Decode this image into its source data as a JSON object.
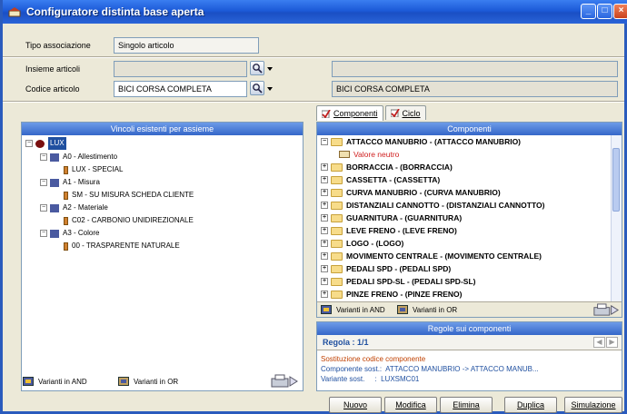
{
  "window": {
    "title": "Configuratore distinta base aperta"
  },
  "form": {
    "tipo_label": "Tipo associazione",
    "tipo_value": "Singolo articolo",
    "insieme_label": "Insieme articoli",
    "codice_label": "Codice articolo",
    "codice_value": "BICI CORSA COMPLETA",
    "right_desc_value": "BICI CORSA COMPLETA"
  },
  "left_panel": {
    "header": "Vincoli esistenti per assieme",
    "tree": {
      "root": "LUX",
      "nodes": [
        {
          "label": "A0 - Allestimento",
          "child": "LUX - SPECIAL"
        },
        {
          "label": "A1 - Misura",
          "child": "SM - SU MISURA SCHEDA CLIENTE"
        },
        {
          "label": "A2 - Materiale",
          "child": "C02 - CARBONIO UNIDIREZIONALE"
        },
        {
          "label": "A3 - Colore",
          "child": "00 - TRASPARENTE NATURALE"
        }
      ]
    },
    "legend_and": "Varianti in AND",
    "legend_or": "Varianti in OR"
  },
  "tabs": {
    "componenti": "Componenti",
    "ciclo": "Ciclo"
  },
  "components_panel": {
    "header": "Componenti",
    "valore_neutro": "Valore neutro",
    "items": [
      "ATTACCO MANUBRIO - (ATTACCO MANUBRIO)",
      "BORRACCIA - (BORRACCIA)",
      "CASSETTA - (CASSETTA)",
      "CURVA MANUBRIO - (CURVA MANUBRIO)",
      "DISTANZIALI CANNOTTO - (DISTANZIALI CANNOTTO)",
      "GUARNITURA - (GUARNITURA)",
      "LEVE FRENO - (LEVE FRENO)",
      "LOGO - (LOGO)",
      "MOVIMENTO CENTRALE - (MOVIMENTO CENTRALE)",
      "PEDALI SPD - (PEDALI SPD)",
      "PEDALI SPD-SL - (PEDALI SPD-SL)",
      "PINZE FRENO - (PINZE FRENO)"
    ],
    "legend_and": "Varianti in AND",
    "legend_or": "Varianti in OR"
  },
  "rules_panel": {
    "header": "Regole sui componenti",
    "regola": "Regola : 1/1",
    "line1": "Sostituzione codice componente",
    "line2": "Componente sost.:  ATTACCO MANUBRIO -> ATTACCO MANUB...",
    "line3": "Variante sost.     :  LUXSMC01"
  },
  "buttons": {
    "nuovo": "Nuovo",
    "modifica": "Modifica",
    "elimina": "Elimina",
    "duplica": "Duplica",
    "simulazione": "Simulazione"
  },
  "colors": {
    "title_bar": "#1c5ad8",
    "panel_header": "#3567c9",
    "valore_neutro": "#d02020",
    "rule_text": "#c04000"
  }
}
